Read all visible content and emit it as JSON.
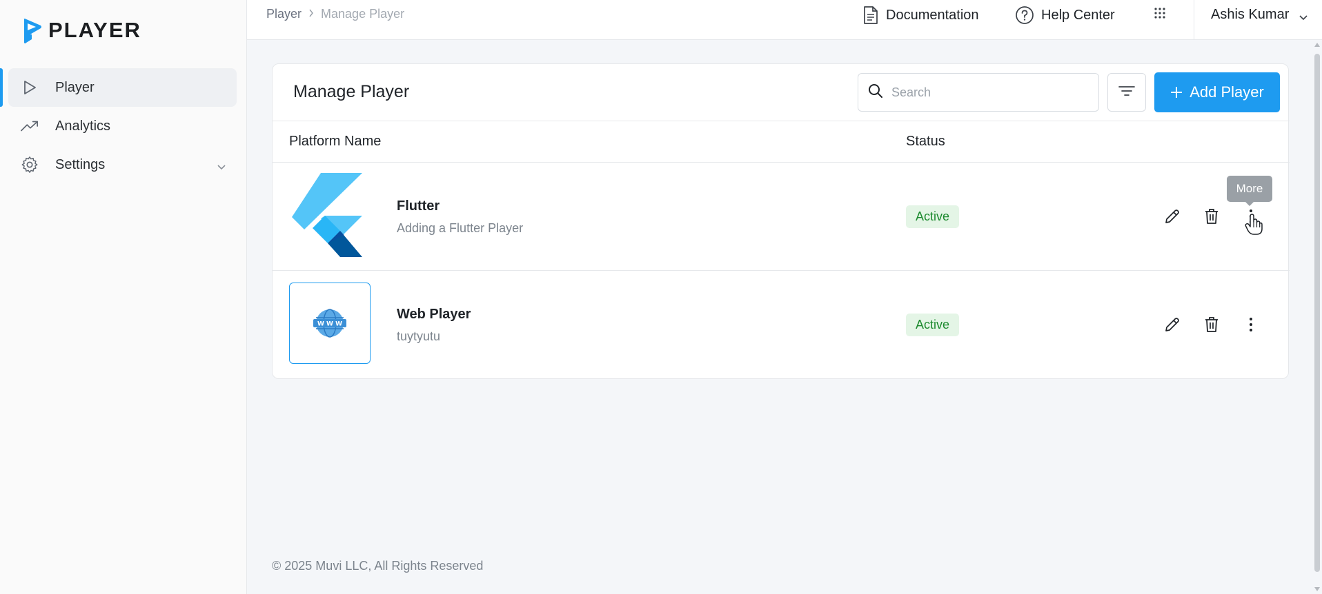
{
  "brand": {
    "name": "PLAYER",
    "accent": "#1e9bf0"
  },
  "sidebar": {
    "items": [
      {
        "label": "Player",
        "icon": "play-icon",
        "active": true
      },
      {
        "label": "Analytics",
        "icon": "trending-up-icon",
        "active": false
      },
      {
        "label": "Settings",
        "icon": "gear-icon",
        "active": false,
        "expandable": true
      }
    ]
  },
  "topbar": {
    "breadcrumb": [
      "Player",
      "Manage Player"
    ],
    "links": {
      "documentation": "Documentation",
      "help": "Help Center"
    },
    "user_name": "Ashis Kumar"
  },
  "main": {
    "title": "Manage Player",
    "search_placeholder": "Search",
    "add_label": "Add Player",
    "columns": {
      "name": "Platform Name",
      "status": "Status"
    },
    "rows": [
      {
        "name": "Flutter",
        "description": "Adding a Flutter Player",
        "status": "Active",
        "thumb": "flutter-logo"
      },
      {
        "name": "Web Player",
        "description": "tuytyutu",
        "status": "Active",
        "thumb": "www-globe-icon"
      }
    ],
    "tooltip": "More"
  },
  "footer": {
    "copyright": "© 2025 Muvi LLC, All Rights Reserved"
  }
}
